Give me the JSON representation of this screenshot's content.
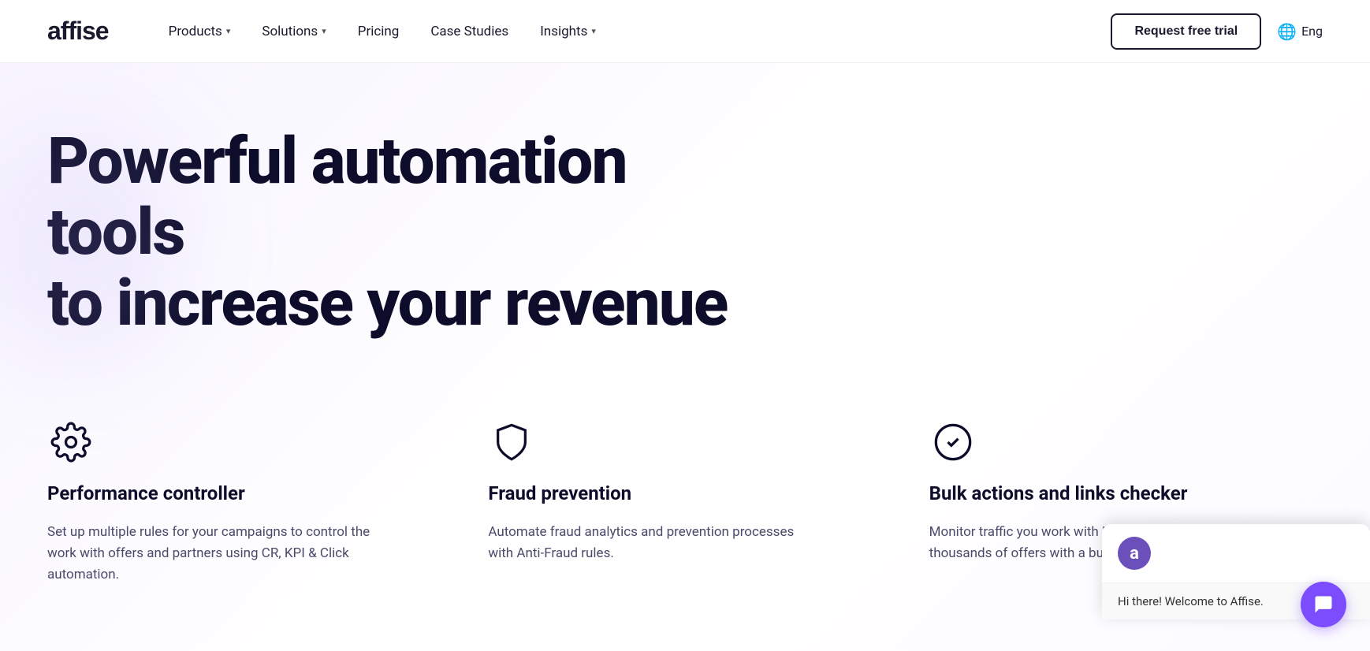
{
  "brand": {
    "logo": "affise"
  },
  "navbar": {
    "items": [
      {
        "label": "Products",
        "has_dropdown": true
      },
      {
        "label": "Solutions",
        "has_dropdown": true
      },
      {
        "label": "Pricing",
        "has_dropdown": false
      },
      {
        "label": "Case Studies",
        "has_dropdown": false
      },
      {
        "label": "Insights",
        "has_dropdown": true
      }
    ],
    "cta_label": "Request free trial",
    "lang_label": "Eng"
  },
  "hero": {
    "title_line1": "Powerful automation tools",
    "title_line2": "to increase your revenue"
  },
  "features": [
    {
      "id": "performance-controller",
      "title": "Performance controller",
      "description": "Set up multiple rules for your campaigns to control the work with offers and partners using CR, KPI & Click automation.",
      "icon": "gear"
    },
    {
      "id": "fraud-prevention",
      "title": "Fraud prevention",
      "description": "Automate fraud analytics and prevention processes with Anti-Fraud rules.",
      "icon": "shield"
    },
    {
      "id": "bulk-actions",
      "title": "Bulk actions and links checker",
      "description": "Monitor traffic you work with Link Checker and edit thousands of offers with a bulk actions bar.",
      "icon": "checkmark"
    }
  ],
  "chat": {
    "avatar_letter": "a",
    "greeting": "Hi there! Welcome to Affise."
  }
}
